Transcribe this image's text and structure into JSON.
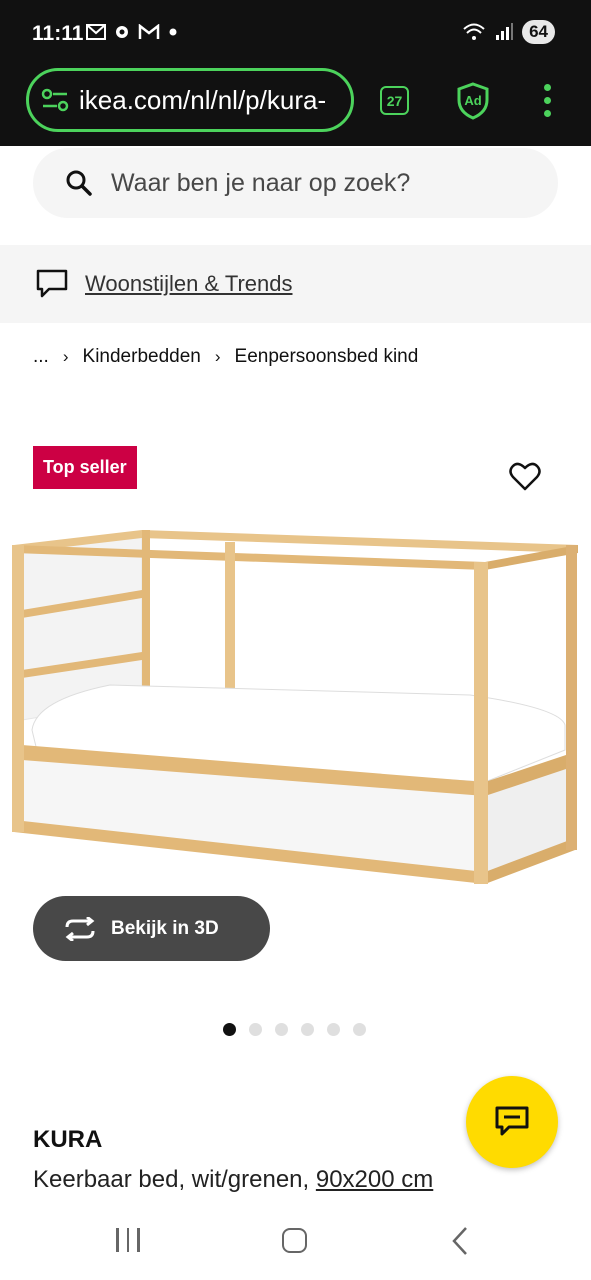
{
  "status_bar": {
    "time": "11:11",
    "battery": "64",
    "notification_icons": [
      "mail-icon",
      "settings-icon",
      "gmail-icon",
      "dot-icon"
    ]
  },
  "browser": {
    "url": "ikea.com/nl/nl/p/kura-",
    "tab_count": "27",
    "adblock_label": "Ad",
    "accent_color": "#4cd35c"
  },
  "search": {
    "placeholder": "Waar ben je naar op zoek?"
  },
  "trends": {
    "label": "Woonstijlen & Trends"
  },
  "breadcrumb": {
    "ellipsis": "...",
    "items": [
      "Kinderbedden",
      "Eenpersoonsbed kind"
    ]
  },
  "product": {
    "badge": "Top seller",
    "badge_color": "#cc0044",
    "view_3d_label": "Bekijk in 3D",
    "image_count": 6,
    "active_image_index": 0,
    "name": "KURA",
    "description": "Keerbaar bed, wit/grenen,",
    "size": "90x200 cm"
  },
  "chat": {
    "color": "#ffdb00"
  }
}
